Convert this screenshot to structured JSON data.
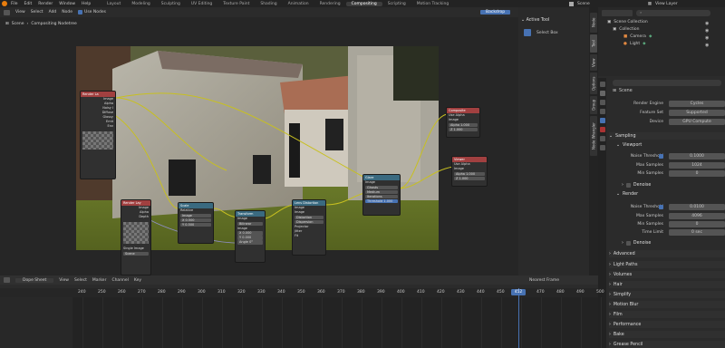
{
  "topbar": {
    "menu": [
      "File",
      "Edit",
      "Render",
      "Window",
      "Help"
    ],
    "workspaces": [
      "Layout",
      "Modeling",
      "Sculpting",
      "UV Editing",
      "Texture Paint",
      "Shading",
      "Animation",
      "Rendering",
      "Compositing",
      "Scripting",
      "Motion Tracking"
    ],
    "active_workspace": "Compositing",
    "scene": "Scene",
    "view_layer": "View Layer"
  },
  "editor": {
    "menu": [
      "View",
      "Select",
      "Add",
      "Node"
    ],
    "use_nodes": "Use Nodes",
    "backdrop": "Backdrop",
    "breadcrumb": [
      "Scene",
      "Compositing Nodetree"
    ]
  },
  "nodes": {
    "render_layers": {
      "title": "Render La",
      "outputs": [
        "Image",
        "Alpha",
        "Noisy I",
        "Diffuse",
        "Glossy",
        "Emit",
        "Env",
        "Shad",
        "AO",
        "Alpha"
      ]
    },
    "render_layers2": {
      "title": "Render Lay",
      "outputs": [
        "Image",
        "Alpha",
        "Depth"
      ],
      "footer": [
        "Single Image",
        "RE",
        "Scene"
      ]
    },
    "scale": {
      "title": "Scale",
      "rows": [
        "Relative",
        "Image",
        "X 0.500",
        "Y 0.500"
      ]
    },
    "transform": {
      "title": "Transform",
      "rows": [
        "Image",
        "Bilinear",
        "Image",
        "X 0.000",
        "Y 0.000",
        "Angle 0°",
        "Scale 1.000"
      ]
    },
    "lens": {
      "title": "Lens Distortion",
      "rows": [
        "Image",
        "Image",
        "Distortion",
        "Dispersion",
        "Projector",
        "Jitter",
        "Fit"
      ]
    },
    "composite": {
      "title": "Composite",
      "rows": [
        "Use Alpha",
        "Image",
        "Alpha 1.000",
        "Z 1.000"
      ]
    },
    "viewer": {
      "title": "Viewer",
      "rows": [
        "Use Alpha",
        "Image",
        "Alpha 1.000",
        "Z 1.000"
      ]
    },
    "glare": {
      "title": "Glare",
      "rows": [
        "Image",
        "Ghosts",
        "Medium",
        "Iterations",
        "Threshold 1.000"
      ]
    }
  },
  "sidebar": {
    "section": "Active Tool",
    "tool": "Select Box",
    "tabs": [
      "Node",
      "Tool",
      "View",
      "Options",
      "Group",
      "Node Wrangler"
    ]
  },
  "outliner": {
    "title": "Scene Collection",
    "items": [
      "Collection",
      "Camera",
      "Light"
    ]
  },
  "properties": {
    "title": "Scene",
    "render_engine": {
      "label": "Render Engine",
      "value": "Cycles"
    },
    "feature_set": {
      "label": "Feature Set",
      "value": "Supported"
    },
    "device": {
      "label": "Device",
      "value": "GPU Compute"
    },
    "sampling": "Sampling",
    "viewport": "Viewport",
    "v_noise": {
      "label": "Noise Threshold",
      "value": "0.1000"
    },
    "v_max": {
      "label": "Max Samples",
      "value": "1024"
    },
    "v_min": {
      "label": "Min Samples",
      "value": "0"
    },
    "denoise": "Denoise",
    "render": "Render",
    "r_noise": {
      "label": "Noise Threshold",
      "value": "0.0100"
    },
    "r_max": {
      "label": "Max Samples",
      "value": "4096"
    },
    "r_min": {
      "label": "Min Samples",
      "value": "0"
    },
    "r_time": {
      "label": "Time Limit",
      "value": "0 sec"
    },
    "panels": [
      "Denoise",
      "Advanced",
      "Light Paths",
      "Volumes",
      "Hair",
      "Simplify",
      "Motion Blur",
      "Film",
      "Performance",
      "Bake",
      "Grease Pencil"
    ]
  },
  "dopesheet": {
    "mode": "Dope Sheet",
    "menu": [
      "View",
      "Select",
      "Marker",
      "Channel",
      "Key"
    ],
    "playback": "Nearest Frame",
    "current_frame": "452",
    "frames": [
      "240",
      "250",
      "260",
      "270",
      "280",
      "290",
      "300",
      "310",
      "320",
      "330",
      "340",
      "350",
      "360",
      "370",
      "380",
      "390",
      "400",
      "410",
      "420",
      "430",
      "440",
      "450",
      "460",
      "470",
      "480",
      "490",
      "500"
    ]
  }
}
